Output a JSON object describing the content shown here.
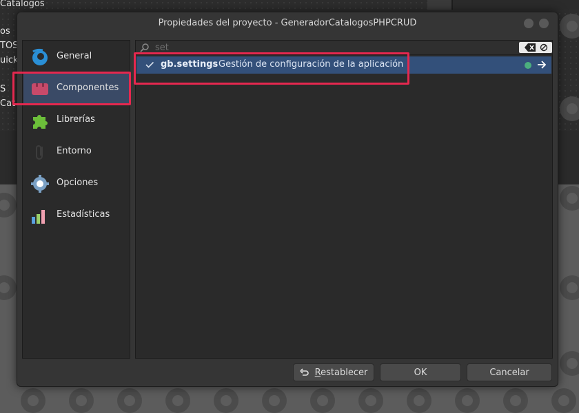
{
  "background": {
    "lines": [
      "Catalogos",
      "os",
      "TOS",
      "uick-",
      "S",
      "Cat"
    ]
  },
  "dialog": {
    "title": "Propiedades del proyecto - GeneradorCatalogosPHPCRUD"
  },
  "sidebar": {
    "items": [
      {
        "label": "General",
        "icon": "gambas-logo-icon"
      },
      {
        "label": "Componentes",
        "icon": "components-icon",
        "active": true
      },
      {
        "label": "Librerías",
        "icon": "puzzle-icon"
      },
      {
        "label": "Entorno",
        "icon": "paperclip-icon"
      },
      {
        "label": "Opciones",
        "icon": "gear-icon"
      },
      {
        "label": "Estadísticas",
        "icon": "bar-chart-icon"
      }
    ]
  },
  "search": {
    "value": "",
    "placeholder": "set"
  },
  "components": [
    {
      "name": "gb.settings",
      "description": "Gestión de configuración de la aplicación",
      "checked": true
    }
  ],
  "buttons": {
    "reset_prefix": "",
    "reset_mnemonic": "R",
    "reset_rest": "establecer",
    "ok": "OK",
    "cancel": "Cancelar"
  },
  "colors": {
    "accent": "#33507a",
    "highlight": "#e5284f",
    "status_dot": "#4caf7e"
  }
}
